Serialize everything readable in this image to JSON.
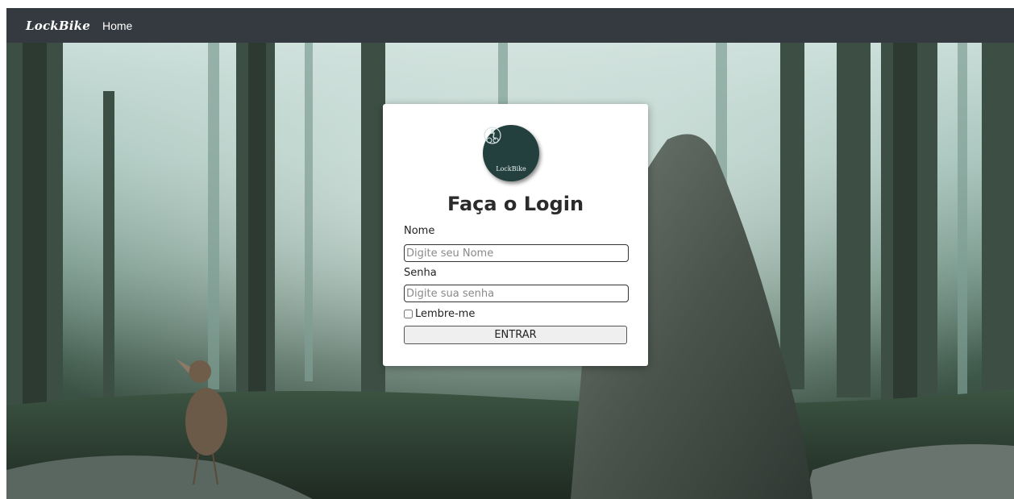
{
  "navbar": {
    "brand": "LockBike",
    "home_link": "Home"
  },
  "login": {
    "logo_text": "LockBike",
    "title": "Faça o Login",
    "name_label": "Nome",
    "name_placeholder": "Digite seu Nome",
    "name_value": "",
    "password_label": "Senha",
    "password_placeholder": "Digite sua senha",
    "password_value": "",
    "remember_label": "Lembre-me",
    "remember_checked": false,
    "submit_label": "ENTRAR"
  },
  "colors": {
    "navbar_bg": "#343a40",
    "logo_bg": "#24403e",
    "card_bg": "#ffffff"
  },
  "background": {
    "scene": "misty-forest-with-rock-and-bird"
  }
}
